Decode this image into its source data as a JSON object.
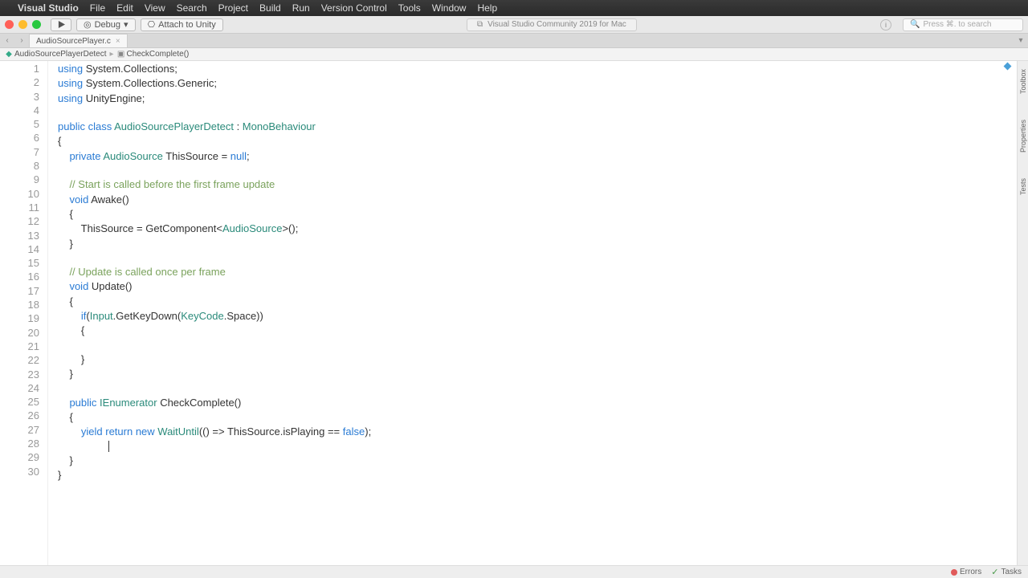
{
  "menubar": {
    "apple": "",
    "app": "Visual Studio",
    "items": [
      "File",
      "Edit",
      "View",
      "Search",
      "Project",
      "Build",
      "Run",
      "Version Control",
      "Tools",
      "Window",
      "Help"
    ]
  },
  "toolbar": {
    "debug": "Debug",
    "attach": "Attach to Unity",
    "center": "Visual Studio Community 2019 for Mac",
    "search_placeholder": "Press ⌘. to search"
  },
  "tab": {
    "name": "AudioSourcePlayer.c"
  },
  "breadcrumb": {
    "file": "AudioSourcePlayerDetect",
    "method": "CheckComplete()"
  },
  "side": {
    "a": "Toolbox",
    "b": "Properties",
    "c": "Tests"
  },
  "status": {
    "errors": "Errors",
    "tasks": "Tasks"
  },
  "code": {
    "lines_count": 30,
    "lines": {
      "l1a": "using",
      "l1b": " System.Collections;",
      "l2a": "using",
      "l2b": " System.Collections.Generic;",
      "l3a": "using",
      "l3b": " UnityEngine;",
      "l5a": "public class ",
      "l5b": "AudioSourcePlayerDetect",
      "l5c": " : ",
      "l5d": "MonoBehaviour",
      "l6": "{",
      "l7a": "    private ",
      "l7b": "AudioSource",
      "l7c": " ThisSource = ",
      "l7d": "null",
      "l7e": ";",
      "l9": "    // Start is called before the first frame update",
      "l10a": "    void ",
      "l10b": "Awake",
      "l10c": "()",
      "l11": "    {",
      "l12a": "        ThisSource = GetComponent<",
      "l12b": "AudioSource",
      "l12c": ">();",
      "l13": "    }",
      "l15": "    // Update is called once per frame",
      "l16a": "    void ",
      "l16b": "Update",
      "l16c": "()",
      "l17": "    {",
      "l18a": "        if",
      "l18b": "(",
      "l18c": "Input",
      "l18d": ".GetKeyDown(",
      "l18e": "KeyCode",
      "l18f": ".Space))",
      "l19": "        {",
      "l21": "        }",
      "l22": "    }",
      "l24a": "    public ",
      "l24b": "IEnumerator",
      "l24c": " CheckComplete()",
      "l25": "    {",
      "l26a": "        yield return new ",
      "l26b": "WaitUntil",
      "l26c": "(() => ThisSource.isPlaying == ",
      "l26d": "false",
      "l26e": ");",
      "l28": "    }",
      "l29": "}"
    }
  }
}
